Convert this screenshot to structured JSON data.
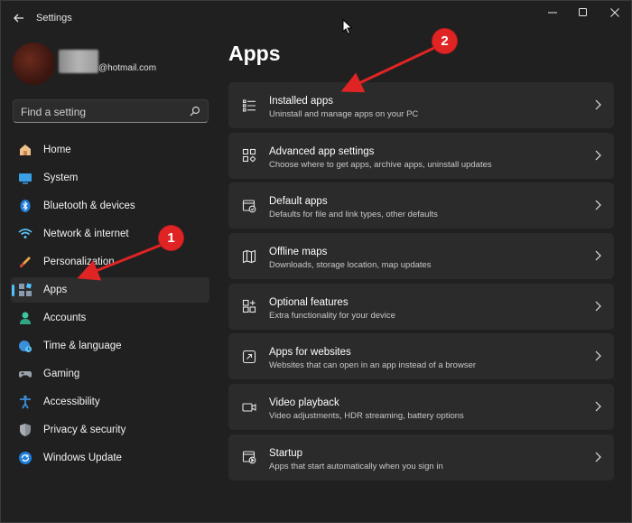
{
  "window": {
    "title": "Settings"
  },
  "profile": {
    "email": "@hotmail.com"
  },
  "search": {
    "placeholder": "Find a setting",
    "icon": "search-icon"
  },
  "sidebar": {
    "accent": "#4cc2ff",
    "items": [
      {
        "label": "Home",
        "icon": "home-icon",
        "selected": false
      },
      {
        "label": "System",
        "icon": "display-icon",
        "selected": false
      },
      {
        "label": "Bluetooth & devices",
        "icon": "bluetooth-icon",
        "selected": false
      },
      {
        "label": "Network & internet",
        "icon": "wifi-icon",
        "selected": false
      },
      {
        "label": "Personalization",
        "icon": "brush-icon",
        "selected": false
      },
      {
        "label": "Apps",
        "icon": "apps-icon",
        "selected": true
      },
      {
        "label": "Accounts",
        "icon": "person-icon",
        "selected": false
      },
      {
        "label": "Time & language",
        "icon": "globe-clock-icon",
        "selected": false
      },
      {
        "label": "Gaming",
        "icon": "gamepad-icon",
        "selected": false
      },
      {
        "label": "Accessibility",
        "icon": "accessibility-icon",
        "selected": false
      },
      {
        "label": "Privacy & security",
        "icon": "shield-icon",
        "selected": false
      },
      {
        "label": "Windows Update",
        "icon": "update-icon",
        "selected": false
      }
    ]
  },
  "main": {
    "title": "Apps",
    "cards": [
      {
        "title": "Installed apps",
        "desc": "Uninstall and manage apps on your PC",
        "icon": "list-icon"
      },
      {
        "title": "Advanced app settings",
        "desc": "Choose where to get apps, archive apps, uninstall updates",
        "icon": "app-settings-icon"
      },
      {
        "title": "Default apps",
        "desc": "Defaults for file and link types, other defaults",
        "icon": "default-apps-icon"
      },
      {
        "title": "Offline maps",
        "desc": "Downloads, storage location, map updates",
        "icon": "map-icon"
      },
      {
        "title": "Optional features",
        "desc": "Extra functionality for your device",
        "icon": "add-grid-icon"
      },
      {
        "title": "Apps for websites",
        "desc": "Websites that can open in an app instead of a browser",
        "icon": "open-link-icon"
      },
      {
        "title": "Video playback",
        "desc": "Video adjustments, HDR streaming, battery options",
        "icon": "video-icon"
      },
      {
        "title": "Startup",
        "desc": "Apps that start automatically when you sign in",
        "icon": "startup-icon"
      }
    ]
  },
  "annotations": {
    "badge1": "1",
    "badge2": "2",
    "color": "#e02424"
  }
}
